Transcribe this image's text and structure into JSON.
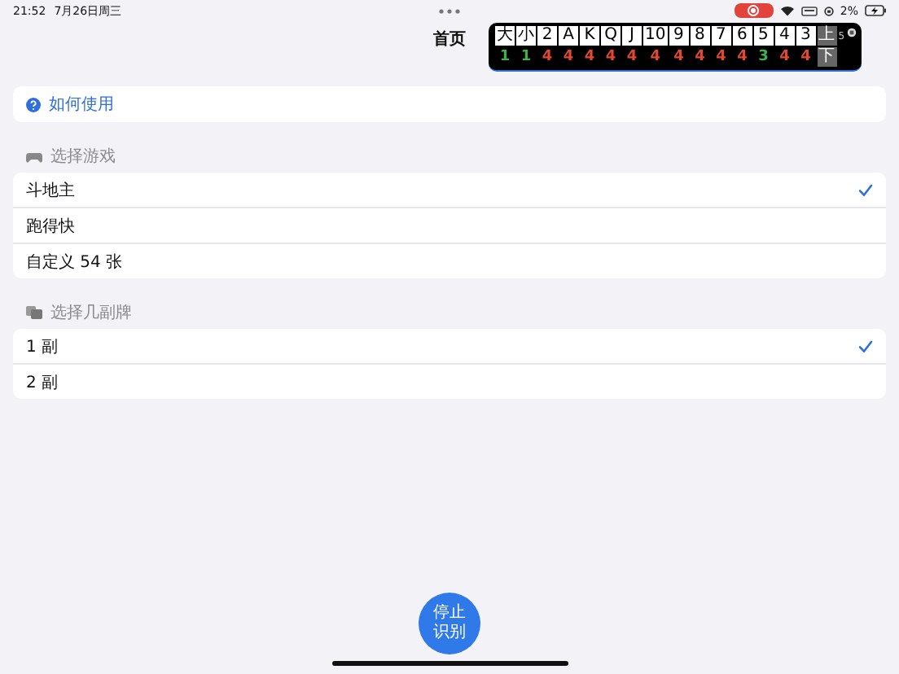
{
  "status_bar": {
    "time": "21:52",
    "date": "7月26日周三",
    "battery": "2%",
    "recording": true
  },
  "nav": {
    "title": "首页"
  },
  "counter_overlay": {
    "cards": [
      "大",
      "小",
      "2",
      "A",
      "K",
      "Q",
      "J",
      "10",
      "9",
      "8",
      "7",
      "6",
      "5",
      "4",
      "3"
    ],
    "top_label": "上",
    "top_note": "5",
    "bottom_label": "下",
    "counts": [
      {
        "text": "1",
        "color": "#3fb04c"
      },
      {
        "text": "1",
        "color": "#3fb04c"
      },
      {
        "text": "4",
        "color": "#e2472f"
      },
      {
        "text": "4",
        "color": "#e2472f"
      },
      {
        "text": "4",
        "color": "#e2472f"
      },
      {
        "text": "4",
        "color": "#e2472f"
      },
      {
        "text": "4",
        "color": "#e2472f"
      },
      {
        "text": "4",
        "color": "#e2472f"
      },
      {
        "text": "4",
        "color": "#e2472f"
      },
      {
        "text": "4",
        "color": "#e2472f"
      },
      {
        "text": "4",
        "color": "#e2472f"
      },
      {
        "text": "4",
        "color": "#e2472f"
      },
      {
        "text": "3",
        "color": "#3fb04c"
      },
      {
        "text": "4",
        "color": "#e2472f"
      },
      {
        "text": "4",
        "color": "#e2472f"
      }
    ]
  },
  "help_link": "如何使用",
  "sections": [
    {
      "header": "选择游戏",
      "kind": "gamepad",
      "items": [
        {
          "label": "斗地主",
          "selected": true
        },
        {
          "label": "跑得快",
          "selected": false
        },
        {
          "label": "自定义 54 张",
          "selected": false
        }
      ]
    },
    {
      "header": "选择几副牌",
      "kind": "cards",
      "items": [
        {
          "label": "1 副",
          "selected": true
        },
        {
          "label": "2 副",
          "selected": false
        }
      ]
    }
  ],
  "action_button": "停止识别"
}
